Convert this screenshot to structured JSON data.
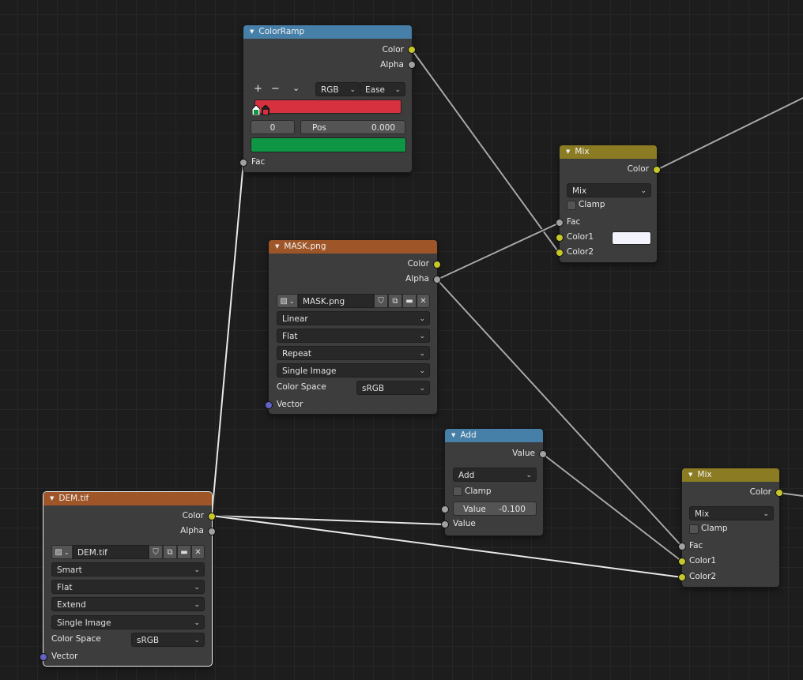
{
  "colorramp": {
    "title": "ColorRamp",
    "out_color": "Color",
    "out_alpha": "Alpha",
    "btn_add": "+",
    "btn_remove": "−",
    "btn_menu": "⌄",
    "color_mode": "RGB",
    "interpolation": "Ease",
    "ramp_color": "#d7303e",
    "stop_index": "0",
    "pos_label": "Pos",
    "pos_value": "0.000",
    "stop_color": "#0f9645",
    "in_fac": "Fac"
  },
  "mask": {
    "title": "MASK.png",
    "out_color": "Color",
    "out_alpha": "Alpha",
    "image_name": "MASK.png",
    "interpolation": "Linear",
    "projection": "Flat",
    "extension": "Repeat",
    "source": "Single Image",
    "color_space_label": "Color Space",
    "color_space": "sRGB",
    "in_vector": "Vector"
  },
  "dem": {
    "title": "DEM.tif",
    "out_color": "Color",
    "out_alpha": "Alpha",
    "image_name": "DEM.tif",
    "interpolation": "Smart",
    "projection": "Flat",
    "extension": "Extend",
    "source": "Single Image",
    "color_space_label": "Color Space",
    "color_space": "sRGB",
    "in_vector": "Vector"
  },
  "mix1": {
    "title": "Mix",
    "out_color": "Color",
    "blend": "Mix",
    "clamp": "Clamp",
    "in_fac": "Fac",
    "in_color1": "Color1",
    "in_color2": "Color2",
    "color1_swatch": "#f3f3fb"
  },
  "add": {
    "title": "Add",
    "out_value": "Value",
    "operation": "Add",
    "clamp": "Clamp",
    "value_label": "Value",
    "value": "-0.100",
    "in_value": "Value"
  },
  "mix2": {
    "title": "Mix",
    "out_color": "Color",
    "blend": "Mix",
    "clamp": "Clamp",
    "in_fac": "Fac",
    "in_color1": "Color1",
    "in_color2": "Color2"
  },
  "colors": {
    "header_converter": "#467fa7",
    "header_texture": "#9e5527",
    "header_color": "#8b7c24",
    "socket_color": "#c7c729",
    "socket_float": "#a1a1a1",
    "socket_vector": "#6363c7",
    "wire": "#a8a8a8",
    "wire_selected": "#e8e8e8"
  }
}
